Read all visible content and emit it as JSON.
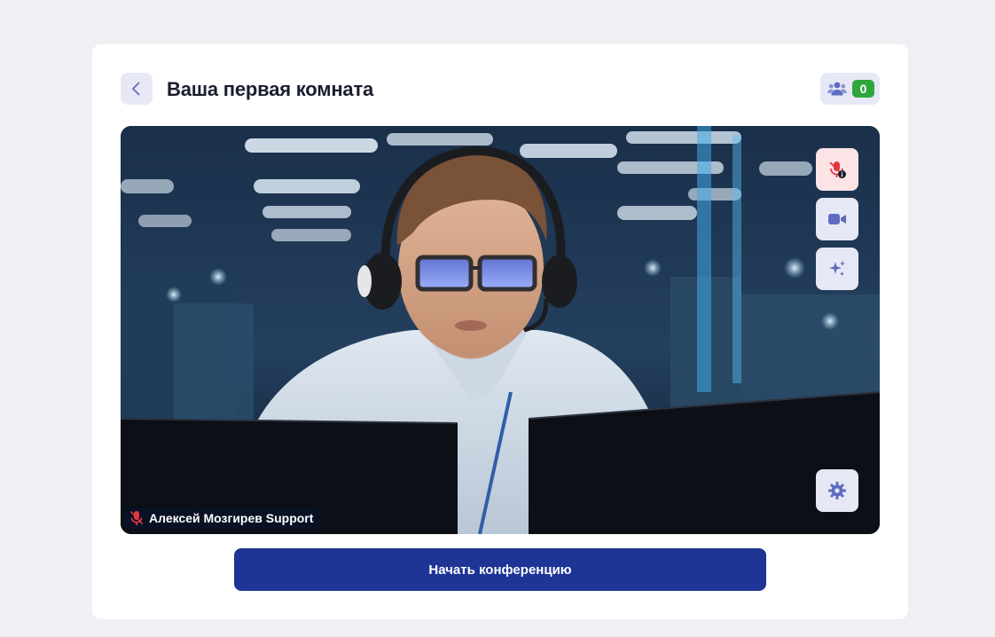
{
  "header": {
    "title": "Ваша первая комната",
    "back_icon": "chevron-left-icon",
    "participants_icon": "users-icon",
    "participants_count": "0"
  },
  "video": {
    "participant_name": "Алексей Мозгирев Support",
    "name_mic_icon": "mic-off-icon",
    "controls": [
      {
        "name": "mic-permission-button",
        "icon": "mic-blocked-icon",
        "state": "blocked"
      },
      {
        "name": "camera-button",
        "icon": "video-camera-icon",
        "state": "on"
      },
      {
        "name": "effects-button",
        "icon": "sparkles-icon",
        "state": "off"
      },
      {
        "name": "settings-button",
        "icon": "gear-icon",
        "state": "off"
      }
    ]
  },
  "actions": {
    "start_label": "Начать конференцию"
  },
  "colors": {
    "accent": "#1e3596",
    "badge_green": "#2ea63b",
    "icon_blue": "#5d6bc0",
    "mic_red": "#e5363f",
    "control_bg": "#e6e9f5",
    "blocked_bg": "#fbe4e6"
  }
}
